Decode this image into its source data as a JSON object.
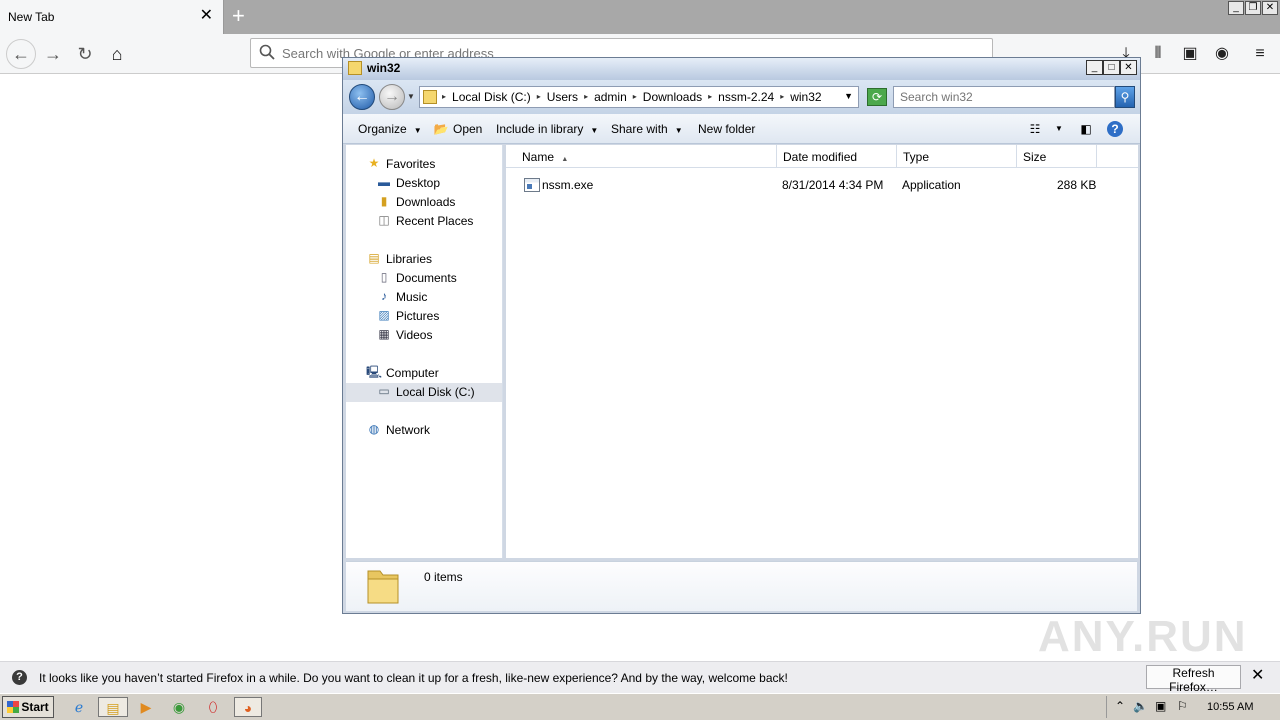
{
  "browser": {
    "tab_title": "New Tab",
    "tab_close": "✕",
    "new_tab": "+",
    "url_placeholder": "Search with Google or enter address",
    "window_controls": [
      "🗕",
      "🗗",
      "✕"
    ]
  },
  "explorer": {
    "title": "win32",
    "breadcrumbs": [
      "Local Disk (C:)",
      "Users",
      "admin",
      "Downloads",
      "nssm-2.24",
      "win32"
    ],
    "search_placeholder": "Search win32",
    "toolbar": {
      "organize": "Organize",
      "open": "Open",
      "include_in_library": "Include in library",
      "share_with": "Share with",
      "new_folder": "New folder"
    },
    "nav": {
      "favorites": "Favorites",
      "desktop": "Desktop",
      "downloads": "Downloads",
      "recent_places": "Recent Places",
      "libraries": "Libraries",
      "documents": "Documents",
      "music": "Music",
      "pictures": "Pictures",
      "videos": "Videos",
      "computer": "Computer",
      "local_disk": "Local Disk (C:)",
      "network": "Network"
    },
    "columns": {
      "name": "Name",
      "date_modified": "Date modified",
      "type": "Type",
      "size": "Size"
    },
    "files": [
      {
        "name": "nssm.exe",
        "date_modified": "8/31/2014 4:34 PM",
        "type": "Application",
        "size": "288 KB"
      }
    ],
    "details_count": "0 items"
  },
  "notification": {
    "text": "It looks like you haven’t started Firefox in a while. Do you want to clean it up for a fresh, like-new experience? And by the way, welcome back!",
    "button": "Refresh Firefox…",
    "close": "✕"
  },
  "watermark": "ANY.RUN",
  "taskbar": {
    "start": "Start",
    "clock": "10:55 AM"
  },
  "colors": {
    "explorer_frame": "#cfd7e3",
    "selected_nav": "#dfe3ea",
    "taskbar": "#d4d0c8"
  }
}
